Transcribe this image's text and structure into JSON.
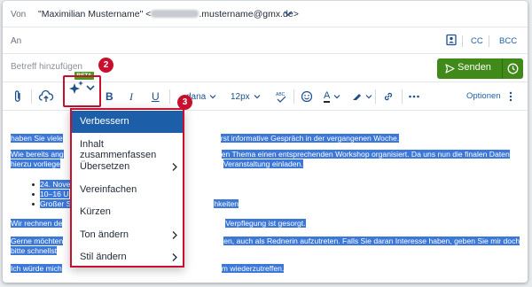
{
  "from": {
    "label": "Von",
    "name": "\"Maximilian Mustername\" <",
    "email_suffix": ".mustername@gmx.de>"
  },
  "to": {
    "label": "An",
    "cc": "CC",
    "bcc": "BCC"
  },
  "subject": {
    "placeholder": "Betreff hinzufügen"
  },
  "send": {
    "label": "Senden"
  },
  "toolbar": {
    "font": "Verdana",
    "font_prefix": "dana",
    "size": "12px",
    "options": "Optionen",
    "beta": "BETA",
    "bold": "B",
    "italic": "I",
    "underline": "U",
    "font_color": "A"
  },
  "badges": [
    "2",
    "3"
  ],
  "ai_menu": {
    "items": [
      {
        "label": "Verbessern",
        "submenu": false,
        "selected": true
      },
      {
        "label": "Inhalt zusammenfassen",
        "submenu": false,
        "selected": false
      },
      {
        "label": "Übersetzen",
        "submenu": true,
        "selected": false
      },
      {
        "label": "Vereinfachen",
        "submenu": false,
        "selected": false
      },
      {
        "label": "Kürzen",
        "submenu": false,
        "selected": false
      },
      {
        "label": "Ton ändern",
        "submenu": true,
        "selected": false
      },
      {
        "label": "Stil ändern",
        "submenu": true,
        "selected": false
      }
    ]
  },
  "body": {
    "p1_left": "haben Sie viele",
    "p1_right": "rst informative Gespräch in der vergangenen Woche.",
    "p2_left": "Wie bereits ang",
    "p2_right": "en Thema einen entsprechenden Workshop organisiert. Da uns nun die finalen Daten",
    "p3_left": "hierzu vorliege",
    "p3_right": "Veranstaltung einladen.",
    "li1": "24. Nove",
    "li2": "10–16 U",
    "li3_left": "Großer S",
    "li3_right": "hkeiten",
    "p4_left": "Wir rechnen de",
    "p4_right": "Verpflegung ist gesorgt.",
    "p5_left": "Gerne möchten",
    "p5_right": "en, auch als Rednerin aufzutreten. Falls Sie daran Interesse haben, geben Sie mir doch",
    "p6_left": "bitte schnellst",
    "p7_left": "Ich würde mich",
    "p7_right": "m wiederzutreffen."
  },
  "colors": {
    "accent": "#1c5fa8",
    "send": "#3f8a18",
    "highlight": "#3c78d8",
    "callout": "#c8102e",
    "beta": "#4a9a1e"
  }
}
